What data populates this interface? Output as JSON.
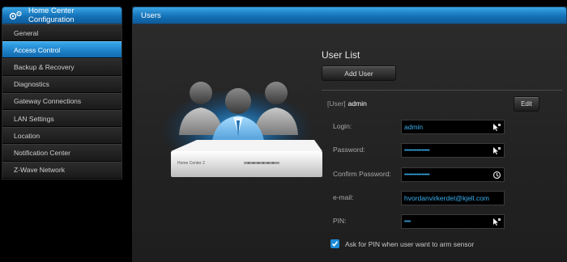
{
  "sidebar": {
    "title": "Home Center Configuration",
    "items": [
      {
        "label": "General",
        "active": false
      },
      {
        "label": "Access Control",
        "active": true
      },
      {
        "label": "Backup & Recovery",
        "active": false
      },
      {
        "label": "Diagnostics",
        "active": false
      },
      {
        "label": "Gateway Connections",
        "active": false
      },
      {
        "label": "LAN Settings",
        "active": false
      },
      {
        "label": "Location",
        "active": false
      },
      {
        "label": "Notification Center",
        "active": false
      },
      {
        "label": "Z-Wave Network",
        "active": false
      }
    ]
  },
  "main": {
    "tab": "Users",
    "device_label": "Home Center 2",
    "user_list_title": "User List",
    "add_user_label": "Add User",
    "user": {
      "tag": "[User]",
      "name": "admin",
      "edit_label": "Edit"
    },
    "fields": {
      "login_label": "Login:",
      "login_value": "admin",
      "password_label": "Password:",
      "password_value": "••••••••••••••••",
      "confirm_label": "Confirm Password:",
      "confirm_value": "••••••••••••••••",
      "email_label": "e-mail:",
      "email_value": "hvordanvirkerdet@kjell.com",
      "pin_label": "PIN:",
      "pin_value": "••••"
    },
    "ask_pin_label": "Ask for PIN when user want to arm sensor",
    "ask_pin_checked": true
  },
  "colors": {
    "accent": "#1b7fc7",
    "field_text": "#3ab0f0"
  }
}
